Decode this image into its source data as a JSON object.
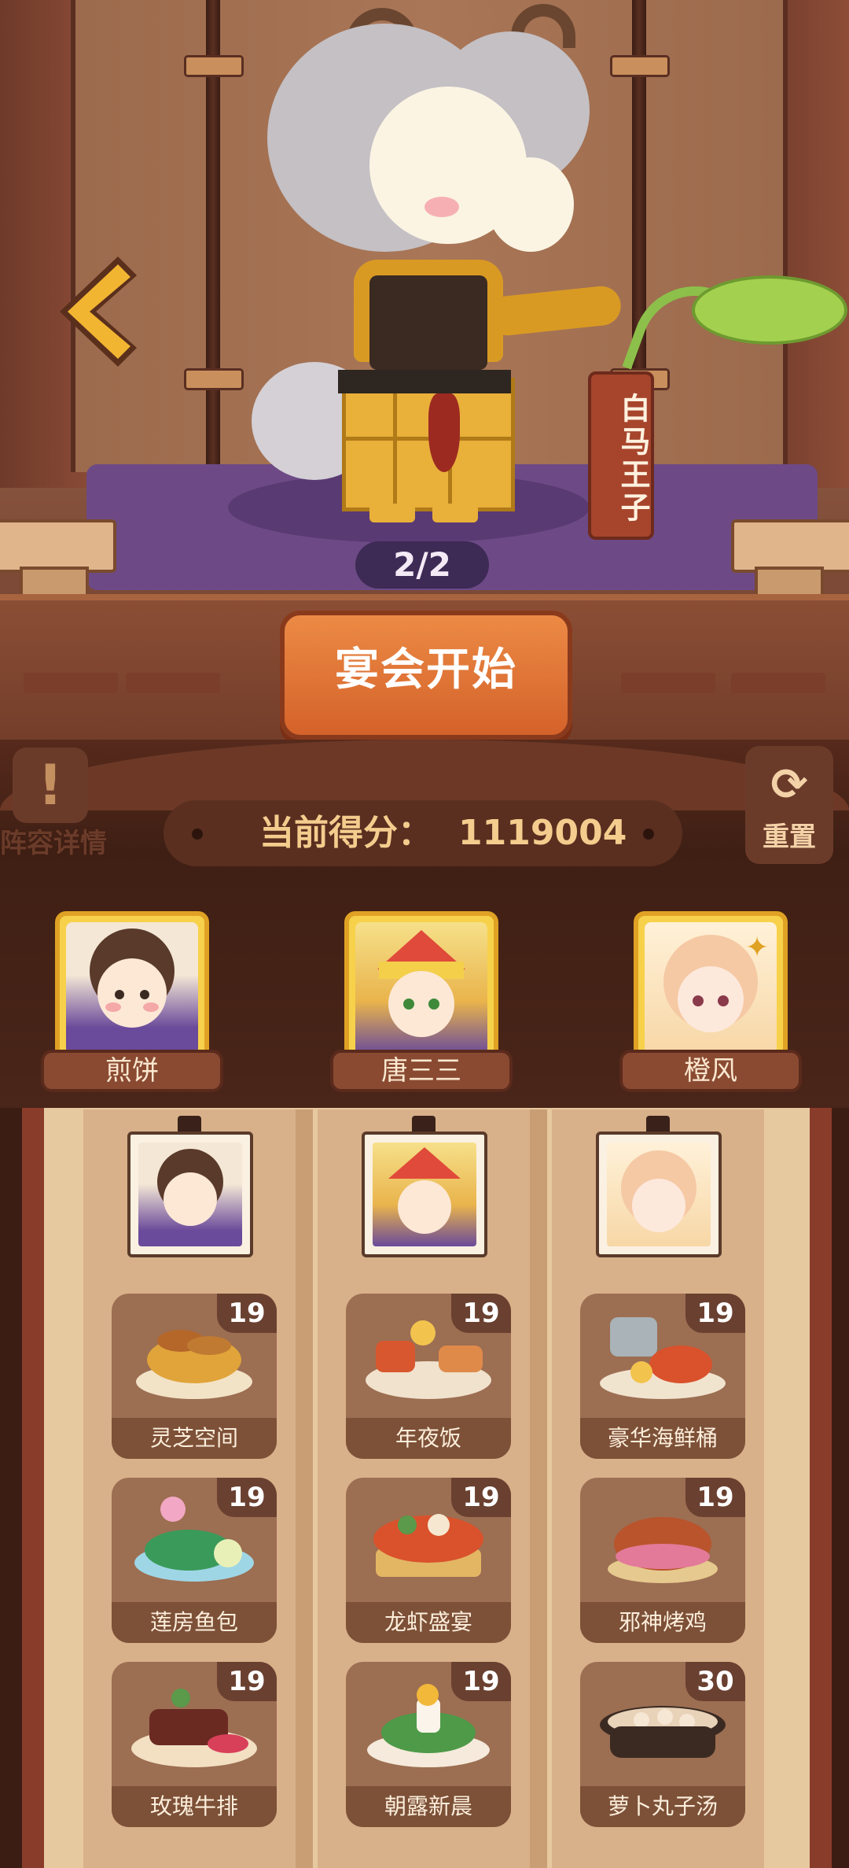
{
  "character": {
    "name_tag": "白马王子"
  },
  "pagination": {
    "current": "2/2"
  },
  "actions": {
    "start_label": "宴会开始",
    "lineup_label": "阵容详情",
    "reset_label": "重置"
  },
  "score": {
    "label": "当前得分：",
    "value": "1119004"
  },
  "heroes": [
    {
      "name": "煎饼"
    },
    {
      "name": "唐三三"
    },
    {
      "name": "橙风"
    }
  ],
  "dishes": [
    {
      "name": "灵芝空间",
      "count": "19"
    },
    {
      "name": "年夜饭",
      "count": "19"
    },
    {
      "name": "豪华海鲜桶",
      "count": "19"
    },
    {
      "name": "莲房鱼包",
      "count": "19"
    },
    {
      "name": "龙虾盛宴",
      "count": "19"
    },
    {
      "name": "邪神烤鸡",
      "count": "19"
    },
    {
      "name": "玫瑰牛排",
      "count": "19"
    },
    {
      "name": "朝露新晨",
      "count": "19"
    },
    {
      "name": "萝卜丸子汤",
      "count": "30"
    }
  ],
  "icons": {
    "back": "chevron-left-icon",
    "lineup": "exclamation-icon",
    "reset": "refresh-icon"
  }
}
